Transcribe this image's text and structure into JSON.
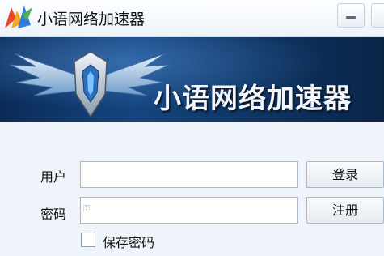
{
  "window": {
    "title": "小语网络加速器",
    "minimize_icon": "minimize-icon"
  },
  "banner": {
    "title": "小语网络加速器",
    "emblem_icon": "winged-shield-emblem"
  },
  "form": {
    "username_label": "用户",
    "username_value": "",
    "password_label": "密码",
    "password_value": "",
    "login_button": "登录",
    "register_button": "注册",
    "remember_label": "保存密码",
    "remember_checked": false
  },
  "colors": {
    "banner_dark": "#0b2b57",
    "banner_mid": "#14457f",
    "window_bg": "#eef4fa"
  }
}
